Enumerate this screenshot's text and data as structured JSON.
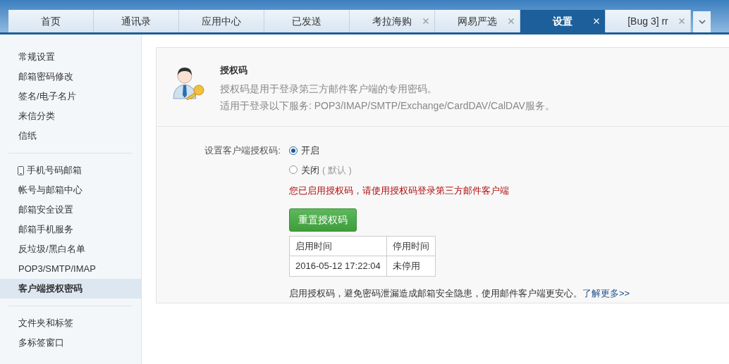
{
  "tabs": [
    {
      "label": "首页",
      "closable": false,
      "selected": false
    },
    {
      "label": "通讯录",
      "closable": false,
      "selected": false
    },
    {
      "label": "应用中心",
      "closable": false,
      "selected": false
    },
    {
      "label": "已发送",
      "closable": false,
      "selected": false
    },
    {
      "label": "考拉海购",
      "closable": true,
      "selected": false
    },
    {
      "label": "网易严选",
      "closable": true,
      "selected": false
    },
    {
      "label": "设置",
      "closable": true,
      "selected": true
    },
    {
      "label": "[Bug 3] rr",
      "closable": true,
      "selected": false
    }
  ],
  "sidebar": {
    "groups": [
      [
        {
          "label": "常规设置",
          "kind": "plain",
          "selected": false
        },
        {
          "label": "邮箱密码修改",
          "kind": "plain",
          "selected": false
        },
        {
          "label": "签名/电子名片",
          "kind": "plain",
          "selected": false
        },
        {
          "label": "来信分类",
          "kind": "plain",
          "selected": false
        },
        {
          "label": "信纸",
          "kind": "plain",
          "selected": false
        }
      ],
      [
        {
          "label": "手机号码邮箱",
          "kind": "phone",
          "selected": false
        },
        {
          "label": "帐号与邮箱中心",
          "kind": "plain",
          "selected": false
        },
        {
          "label": "邮箱安全设置",
          "kind": "plain",
          "selected": false
        },
        {
          "label": "邮箱手机服务",
          "kind": "plain",
          "selected": false
        },
        {
          "label": "反垃圾/黑白名单",
          "kind": "plain",
          "selected": false
        },
        {
          "label": "POP3/SMTP/IMAP",
          "kind": "plain",
          "selected": false
        },
        {
          "label": "客户端授权密码",
          "kind": "plain",
          "selected": true
        }
      ],
      [
        {
          "label": "文件夹和标签",
          "kind": "plain",
          "selected": false
        },
        {
          "label": "多标签窗口",
          "kind": "plain",
          "selected": false
        }
      ]
    ]
  },
  "intro": {
    "title": "授权码",
    "lines": [
      "授权码是用于登录第三方邮件客户端的专用密码。",
      "适用于登录以下服务: POP3/IMAP/SMTP/Exchange/CardDAV/CalDAV服务。"
    ]
  },
  "setting": {
    "label": "设置客户端授权码:",
    "options": [
      {
        "label": "开启",
        "selected": true
      },
      {
        "label": "关闭",
        "note": "( 默认 )",
        "selected": false
      }
    ],
    "status_text": "您已启用授权码，请使用授权码登录第三方邮件客户端",
    "button": "重置授权码",
    "table": {
      "columns": [
        "启用时间",
        "停用时间"
      ],
      "rows": [
        [
          "2016-05-12 17:22:04",
          "未停用"
        ]
      ]
    },
    "footer": {
      "text": "启用授权码，避免密码泄漏造成邮箱安全隐患，使用邮件客户端更安心。",
      "link": "了解更多>>"
    }
  }
}
